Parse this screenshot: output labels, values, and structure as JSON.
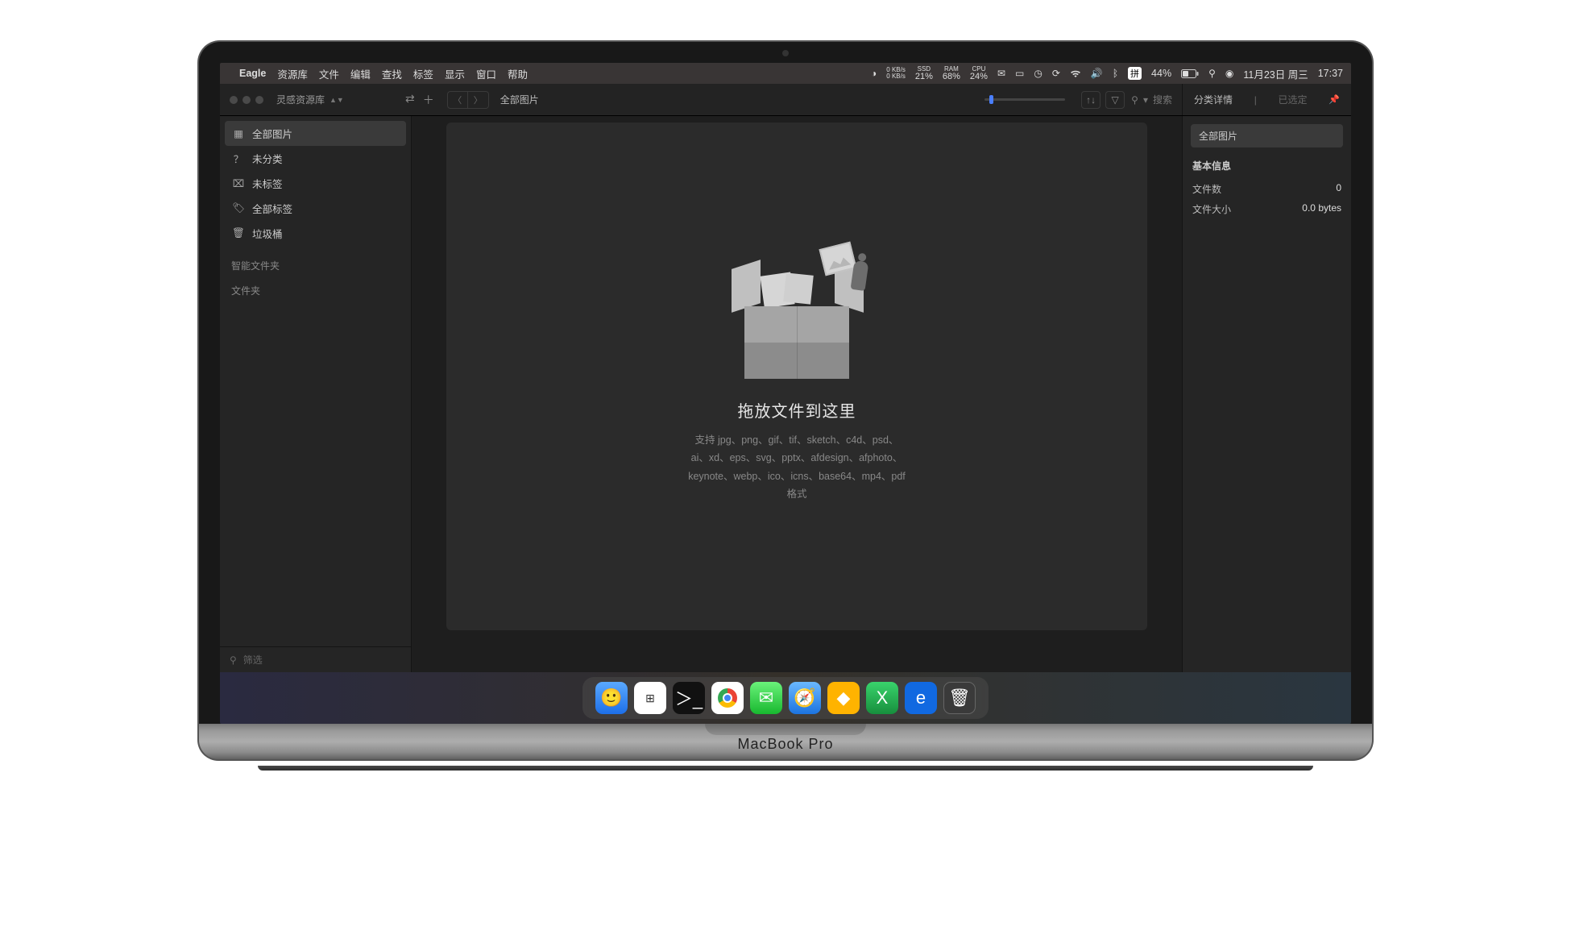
{
  "menubar": {
    "app": "Eagle",
    "items": [
      "资源库",
      "文件",
      "编辑",
      "查找",
      "标签",
      "显示",
      "窗口",
      "帮助"
    ],
    "net_up": "0 KB/s",
    "net_down": "0 KB/s",
    "ssd_label": "SSD",
    "ssd": "21%",
    "ram_label": "RAM",
    "ram": "68%",
    "cpu_label": "CPU",
    "cpu": "24%",
    "ime": "拼",
    "battery": "44%",
    "date": "11月23日 周三",
    "time": "17:37"
  },
  "toolbar": {
    "library_name": "灵感资源库",
    "breadcrumb": "全部图片",
    "search_placeholder": "搜索",
    "details_tab": "分类详情",
    "selected_tab": "已选定"
  },
  "sidebar": {
    "items": [
      {
        "icon": "grid",
        "label": "全部图片",
        "active": true
      },
      {
        "icon": "question",
        "label": "未分类",
        "active": false
      },
      {
        "icon": "tag-x",
        "label": "未标签",
        "active": false
      },
      {
        "icon": "tags",
        "label": "全部标签",
        "active": false
      },
      {
        "icon": "trash",
        "label": "垃圾桶",
        "active": false
      }
    ],
    "group_smart": "智能文件夹",
    "group_folders": "文件夹",
    "filter_placeholder": "筛选"
  },
  "dropzone": {
    "title": "拖放文件到这里",
    "line1": "支持 jpg、png、gif、tif、sketch、c4d、psd、",
    "line2": "ai、xd、eps、svg、pptx、afdesign、afphoto、",
    "line3": "keynote、webp、ico、icns、base64、mp4、pdf",
    "line4": "格式"
  },
  "rightpanel": {
    "chip": "全部图片",
    "section": "基本信息",
    "rows": [
      {
        "k": "文件数",
        "v": "0"
      },
      {
        "k": "文件大小",
        "v": "0.0 bytes"
      }
    ]
  },
  "dock": [
    "Finder",
    "Launchpad",
    "Terminal",
    "Chrome",
    "WeChat",
    "Safari",
    "Sketch",
    "Excel",
    "Edge",
    "Trash"
  ],
  "laptop_label": "MacBook Pro"
}
